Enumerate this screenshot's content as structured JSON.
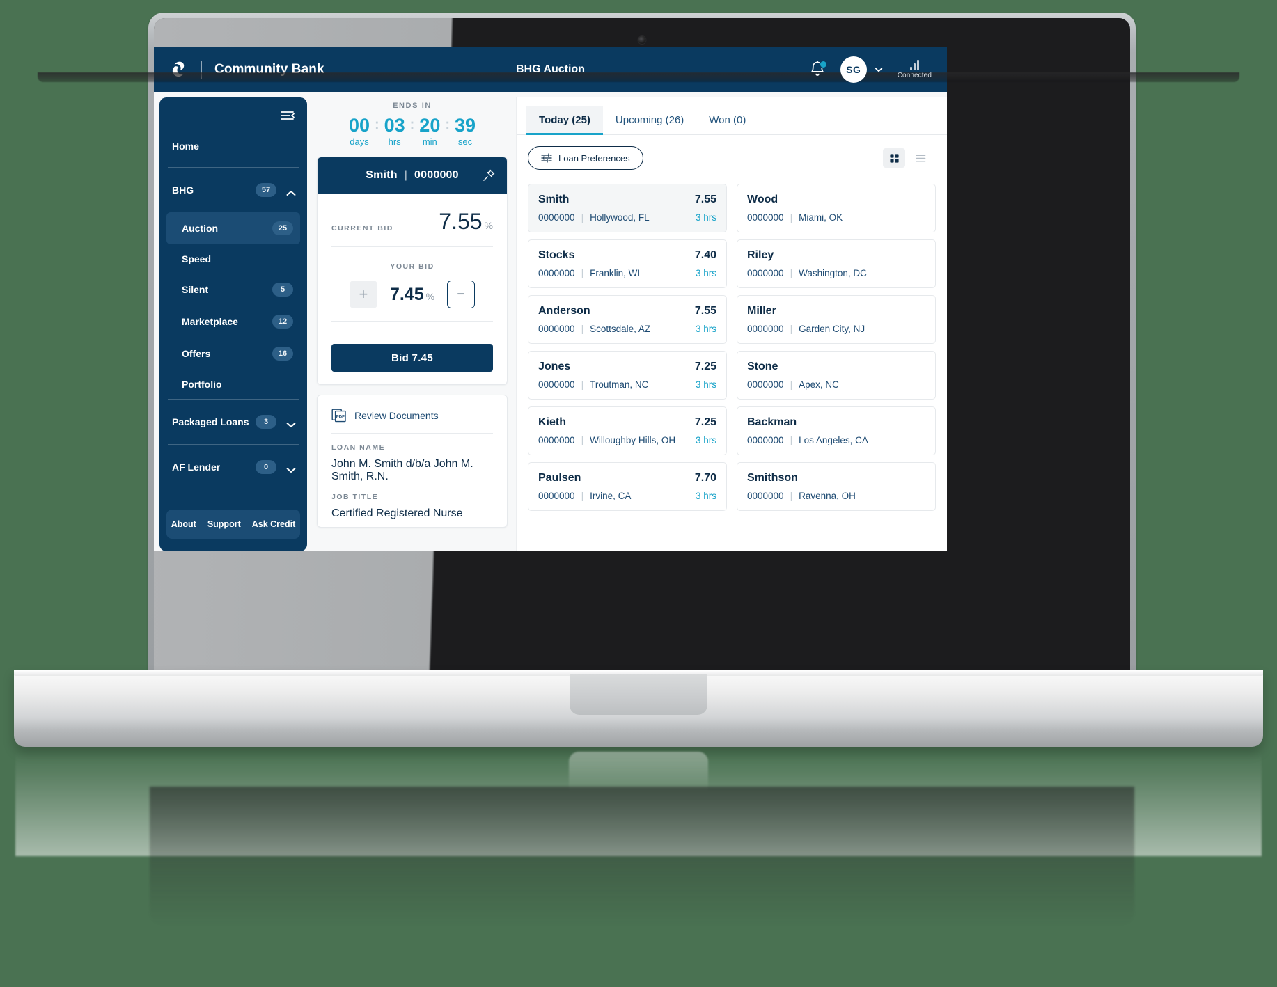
{
  "appbar": {
    "brand_name": "Community Bank",
    "title": "BHG Auction",
    "logo_icon": "swirl-logo-icon",
    "bell_icon": "notification-bell-icon",
    "avatar_initials": "SG",
    "chevron_icon": "chevron-down-icon",
    "signal_icon": "signal-bars-icon",
    "connection_status": "Connected"
  },
  "sidebar": {
    "collapse_icon": "collapse-sidebar-icon",
    "home_label": "Home",
    "groups": [
      {
        "label": "BHG",
        "badge": "57",
        "caret": "chevron-up-icon",
        "expanded": true
      },
      {
        "label": "Packaged Loans",
        "badge": "3",
        "caret": "chevron-down-icon",
        "expanded": false
      },
      {
        "label": "AF Lender",
        "badge": "0",
        "caret": "chevron-down-icon",
        "expanded": false
      }
    ],
    "items": [
      {
        "label": "Auction",
        "badge": "25",
        "active": true
      },
      {
        "label": "Speed",
        "badge": "",
        "active": false
      },
      {
        "label": "Silent",
        "badge": "5",
        "active": false
      },
      {
        "label": "Marketplace",
        "badge": "12",
        "active": false
      },
      {
        "label": "Offers",
        "badge": "16",
        "active": false
      },
      {
        "label": "Portfolio",
        "badge": "",
        "active": false
      }
    ],
    "footer_links": [
      "About",
      "Support",
      "Ask Credit"
    ]
  },
  "center": {
    "ends_in_label": "ENDS IN",
    "countdown": [
      {
        "value": "00",
        "unit": "days"
      },
      {
        "value": "03",
        "unit": "hrs"
      },
      {
        "value": "20",
        "unit": "min"
      },
      {
        "value": "39",
        "unit": "sec"
      }
    ],
    "bid_card": {
      "borrower": "Smith",
      "loan_id": "0000000",
      "separator": "|",
      "pin_icon": "pin-icon",
      "current_bid_label": "CURRENT BID",
      "current_bid_value": "7.55",
      "percent": "%",
      "your_bid_label": "YOUR BID",
      "increment_icon": "plus-icon",
      "decrement_icon": "minus-icon",
      "your_bid_value": "7.45",
      "bid_button_label": "Bid  7.45"
    },
    "documents": {
      "pdf_icon": "pdf-document-icon",
      "review_label": "Review Documents",
      "fields": [
        {
          "label": "LOAN NAME",
          "value": "John M. Smith d/b/a John M. Smith, R.N."
        },
        {
          "label": "JOB TITLE",
          "value": "Certified Registered Nurse"
        }
      ]
    }
  },
  "right_panel": {
    "tabs": [
      {
        "label": "Today (25)",
        "active": true
      },
      {
        "label": "Upcoming (26)",
        "active": false
      },
      {
        "label": "Won (0)",
        "active": false
      }
    ],
    "loan_preferences_label": "Loan Preferences",
    "preferences_icon": "filter-sliders-icon",
    "grid_view_icon": "grid-view-icon",
    "list_view_icon": "list-view-icon",
    "loans": [
      {
        "name": "Smith",
        "rate": "7.55",
        "id": "0000000",
        "location": "Hollywood, FL",
        "time": "3 hrs",
        "selected": true
      },
      {
        "name": "Wood",
        "rate": "",
        "id": "0000000",
        "location": "Miami, OK",
        "time": "",
        "selected": false
      },
      {
        "name": "Stocks",
        "rate": "7.40",
        "id": "0000000",
        "location": "Franklin, WI",
        "time": "3 hrs",
        "selected": false
      },
      {
        "name": "Riley",
        "rate": "",
        "id": "0000000",
        "location": "Washington, DC",
        "time": "",
        "selected": false
      },
      {
        "name": "Anderson",
        "rate": "7.55",
        "id": "0000000",
        "location": "Scottsdale, AZ",
        "time": "3 hrs",
        "selected": false
      },
      {
        "name": "Miller",
        "rate": "",
        "id": "0000000",
        "location": "Garden City, NJ",
        "time": "",
        "selected": false
      },
      {
        "name": "Jones",
        "rate": "7.25",
        "id": "0000000",
        "location": "Troutman, NC",
        "time": "3 hrs",
        "selected": false
      },
      {
        "name": "Stone",
        "rate": "",
        "id": "0000000",
        "location": "Apex, NC",
        "time": "",
        "selected": false
      },
      {
        "name": "Kieth",
        "rate": "7.25",
        "id": "0000000",
        "location": "Willoughby Hills, OH",
        "time": "3 hrs",
        "selected": false
      },
      {
        "name": "Backman",
        "rate": "",
        "id": "0000000",
        "location": "Los Angeles, CA",
        "time": "",
        "selected": false
      },
      {
        "name": "Paulsen",
        "rate": "7.70",
        "id": "0000000",
        "location": "Irvine, CA",
        "time": "3 hrs",
        "selected": false
      },
      {
        "name": "Smithson",
        "rate": "",
        "id": "0000000",
        "location": "Ravenna, OH",
        "time": "",
        "selected": false
      }
    ]
  },
  "colors": {
    "navy": "#0a3a60",
    "teal": "#18a3c9",
    "page_background": "#4a7252",
    "surface": "#ffffff",
    "muted_text": "#7c8894"
  }
}
